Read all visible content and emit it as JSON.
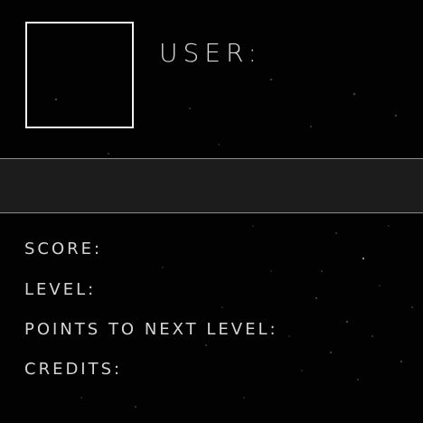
{
  "profile": {
    "user_label": "USER:",
    "score_label": "SCORE:",
    "level_label": "LEVEL:",
    "next_level_label": "POINTS TO NEXT LEVEL:",
    "credits_label": "CREDITS:"
  },
  "colors": {
    "background": "#020202",
    "band": "#1c1c1c",
    "text": "#d9d9d9",
    "avatar_border": "#f2f2f2"
  }
}
